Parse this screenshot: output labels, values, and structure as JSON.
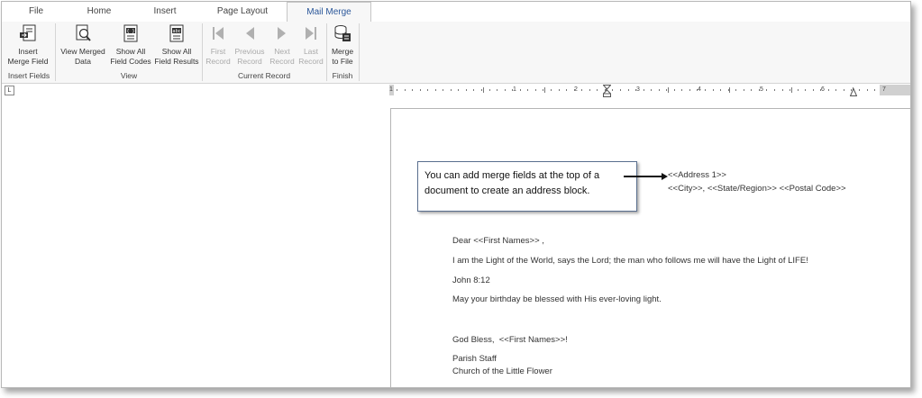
{
  "tabs": [
    "File",
    "Home",
    "Insert",
    "Page Layout",
    "Mail Merge"
  ],
  "active_tab": "Mail Merge",
  "ribbon": {
    "insert_merge_field": "Insert\nMerge Field",
    "view_merged_data": "View Merged\nData",
    "show_all_field_codes": "Show All\nField Codes",
    "show_all_field_results": "Show All\nField Results",
    "first_record": "First\nRecord",
    "previous_record": "Previous\nRecord",
    "next_record": "Next\nRecord",
    "last_record": "Last\nRecord",
    "merge_to_file": "Merge\nto File",
    "groups": {
      "insert_fields": "Insert Fields",
      "view": "View",
      "current_record": "Current Record",
      "finish": "Finish"
    }
  },
  "ruler": {
    "numbers": [
      "1",
      "1",
      "2",
      "3",
      "4",
      "5",
      "6",
      "7"
    ]
  },
  "callout": {
    "line1": "You can add merge fields at the top of a",
    "line2": "document to create an address block."
  },
  "document": {
    "address_line1": "<<Address 1>>",
    "address_line2": "<<City>>, <<State/Region>> <<Postal Code>>",
    "greeting": "Dear <<First Names>> ,",
    "body1": "I am the Light of the World, says the Lord; the man who follows me will have the Light of LIFE!",
    "verse": "John 8:12",
    "body2": "May your birthday be blessed with His ever-loving light.",
    "closing": "God Bless,  <<First Names>>!",
    "signature1": "Parish Staff",
    "signature2": "Church of the Little Flower"
  },
  "colors": {
    "accent": "#2b579a",
    "ribbon_bg": "#f7f7f7",
    "callout_border": "#5a6f8f"
  }
}
